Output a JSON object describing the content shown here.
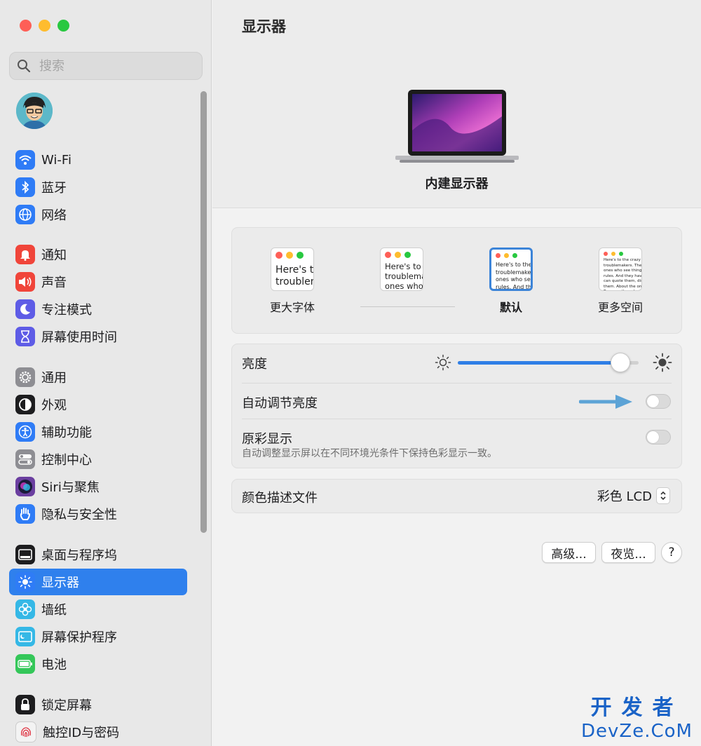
{
  "window": {
    "traffic_colors": [
      "#fe5f57",
      "#febc2e",
      "#28c840"
    ]
  },
  "sidebar": {
    "search_placeholder": "搜索",
    "groups": [
      [
        {
          "label": "Wi-Fi",
          "icon": "wifi-icon",
          "color": "#2f7cf6"
        },
        {
          "label": "蓝牙",
          "icon": "bluetooth-icon",
          "color": "#2f7cf6"
        },
        {
          "label": "网络",
          "icon": "globe-icon",
          "color": "#2f7cf6"
        }
      ],
      [
        {
          "label": "通知",
          "icon": "bell-icon",
          "color": "#f0453a"
        },
        {
          "label": "声音",
          "icon": "speaker-icon",
          "color": "#f0453a"
        },
        {
          "label": "专注模式",
          "icon": "moon-icon",
          "color": "#5e5ce6"
        },
        {
          "label": "屏幕使用时间",
          "icon": "hourglass-icon",
          "color": "#5e5ce6"
        }
      ],
      [
        {
          "label": "通用",
          "icon": "gear-icon",
          "color": "#8e8e93"
        },
        {
          "label": "外观",
          "icon": "appearance-icon",
          "color": "#1d1d1f"
        },
        {
          "label": "辅助功能",
          "icon": "accessibility-icon",
          "color": "#2f7cf6"
        },
        {
          "label": "控制中心",
          "icon": "control-center-icon",
          "color": "#8e8e93"
        },
        {
          "label": "Siri与聚焦",
          "icon": "siri-icon",
          "color": "#6b3fa0"
        },
        {
          "label": "隐私与安全性",
          "icon": "hand-icon",
          "color": "#2f7cf6"
        }
      ],
      [
        {
          "label": "桌面与程序坞",
          "icon": "dock-icon",
          "color": "#1d1d1f"
        },
        {
          "label": "显示器",
          "icon": "sun-icon",
          "color": "#2f7cf6",
          "selected": true
        },
        {
          "label": "墙纸",
          "icon": "flower-icon",
          "color": "#35b8e6"
        },
        {
          "label": "屏幕保护程序",
          "icon": "screensaver-icon",
          "color": "#35b8e6"
        },
        {
          "label": "电池",
          "icon": "battery-icon",
          "color": "#34c759"
        }
      ],
      [
        {
          "label": "锁定屏幕",
          "icon": "lock-icon",
          "color": "#1d1d1f"
        },
        {
          "label": "触控ID与密码",
          "icon": "fingerprint-icon",
          "color": "#f3f3f3"
        }
      ]
    ]
  },
  "main": {
    "title": "显示器",
    "display_name": "内建显示器",
    "resolutions": [
      {
        "label": "更大字体",
        "sample": "Here's to\ntroublem",
        "selected": false
      },
      {
        "label": "",
        "sample": "Here's to t\ntroublema\nones who",
        "selected": false
      },
      {
        "label": "默认",
        "sample": "Here's to the c\ntroublemakers.\nones who see t\nrules. And they",
        "selected": true
      },
      {
        "label": "更多空间",
        "sample": "Here's to the crazy one\ntroublemakers. The rou\nones who see things dif\nrules. And they have no\ncan quote them, disagre\nthem. About the only th\nBecause they change th",
        "selected": false
      }
    ],
    "brightness_label": "亮度",
    "brightness_level": 0.9,
    "auto_brightness_label": "自动调节亮度",
    "auto_brightness_on": false,
    "true_tone_label": "原彩显示",
    "true_tone_desc": "自动调整显示屏以在不同环境光条件下保持色彩显示一致。",
    "true_tone_on": false,
    "color_profile_label": "颜色描述文件",
    "color_profile_value": "彩色 LCD",
    "advanced_button": "高级...",
    "night_shift_button": "夜览...",
    "help_button": "?"
  },
  "watermark": {
    "line1": "开发者",
    "line2": "DevZe.CoM"
  }
}
